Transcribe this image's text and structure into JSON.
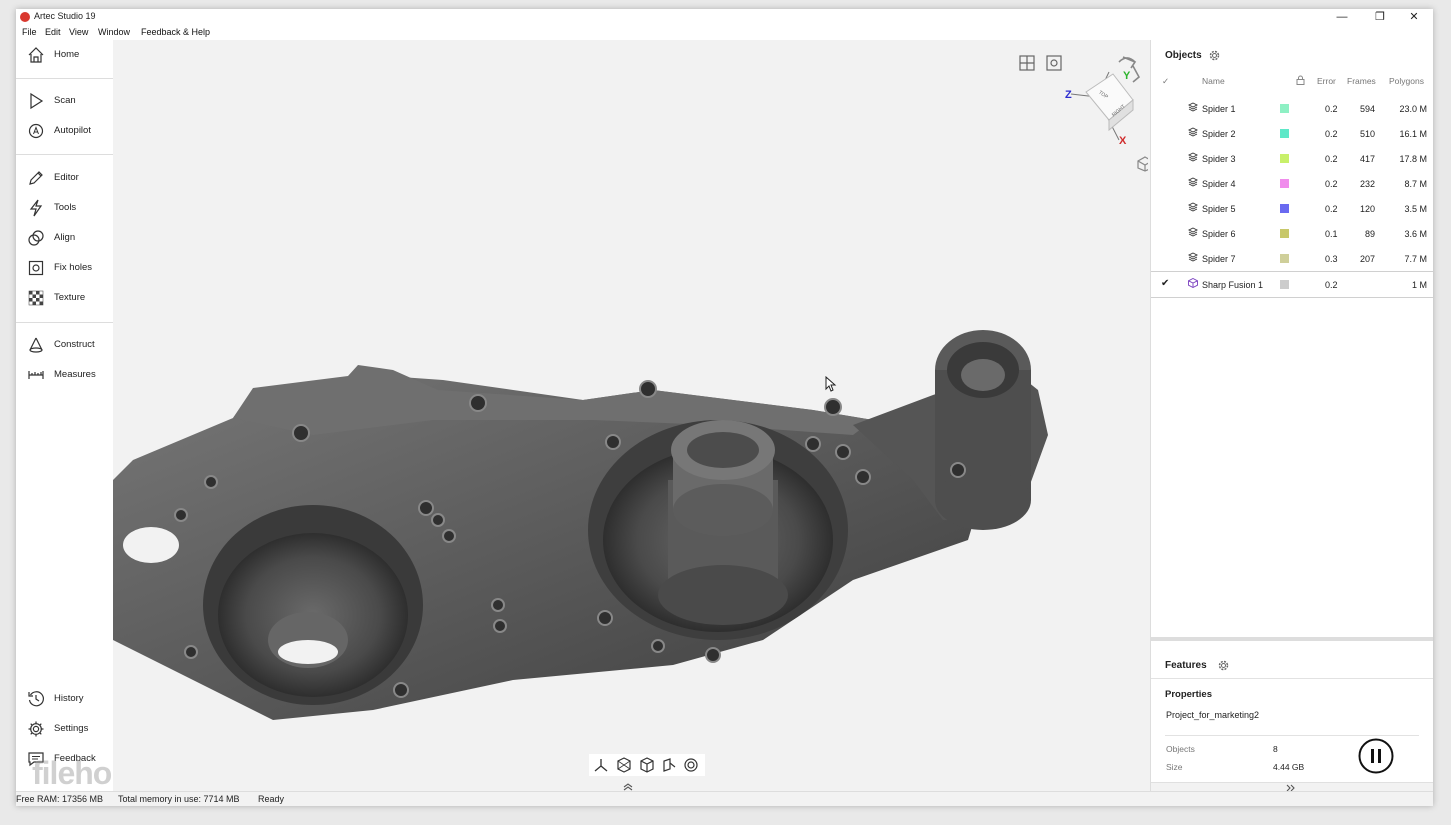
{
  "app": {
    "title": "Artec Studio 19"
  },
  "window_controls": {
    "minimize": "—",
    "restore": "❐",
    "close": "✕"
  },
  "menu": [
    "File",
    "Edit",
    "View",
    "Window",
    "Feedback & Help"
  ],
  "nav": {
    "home": "Home",
    "scan": "Scan",
    "autopilot": "Autopilot",
    "editor": "Editor",
    "tools": "Tools",
    "align": "Align",
    "fix_holes": "Fix holes",
    "texture": "Texture",
    "construct": "Construct",
    "measures": "Measures",
    "history": "History",
    "settings": "Settings",
    "feedback": "Feedback"
  },
  "gizmo": {
    "x": "X",
    "y": "Y",
    "z": "Z",
    "top": "TOP",
    "right": "RIGHT"
  },
  "objects_panel": {
    "title": "Objects",
    "columns": {
      "name": "Name",
      "error": "Error",
      "frames": "Frames",
      "polygons": "Polygons"
    },
    "rows": [
      {
        "name": "Spider 1",
        "color": "#8ef0c4",
        "error": "0.2",
        "frames": "594",
        "polygons": "23.0 M",
        "checked": false
      },
      {
        "name": "Spider 2",
        "color": "#5ee8c8",
        "error": "0.2",
        "frames": "510",
        "polygons": "16.1 M",
        "checked": false
      },
      {
        "name": "Spider 3",
        "color": "#c8f06a",
        "error": "0.2",
        "frames": "417",
        "polygons": "17.8 M",
        "checked": false
      },
      {
        "name": "Spider 4",
        "color": "#f08cec",
        "error": "0.2",
        "frames": "232",
        "polygons": "8.7 M",
        "checked": false
      },
      {
        "name": "Spider 5",
        "color": "#6a6af0",
        "error": "0.2",
        "frames": "120",
        "polygons": "3.5 M",
        "checked": false
      },
      {
        "name": "Spider 6",
        "color": "#c8c86a",
        "error": "0.1",
        "frames": "89",
        "polygons": "3.6 M",
        "checked": false
      },
      {
        "name": "Spider 7",
        "color": "#cfcf9a",
        "error": "0.3",
        "frames": "207",
        "polygons": "7.7 M",
        "checked": false
      },
      {
        "name": "Sharp Fusion 1",
        "color": "#cccccc",
        "error": "0.2",
        "frames": "",
        "polygons": "1 M",
        "checked": true
      }
    ]
  },
  "features_panel": {
    "title": "Features"
  },
  "properties": {
    "title": "Properties",
    "project_name": "Project_for_marketing2",
    "objects_label": "Objects",
    "objects_value": "8",
    "size_label": "Size",
    "size_value": "4.44 GB"
  },
  "status": {
    "free_ram": "Free RAM: 17356 MB",
    "total_memory": "Total memory in use: 7714 MB",
    "state": "Ready"
  },
  "watermark": "filehorse.com"
}
